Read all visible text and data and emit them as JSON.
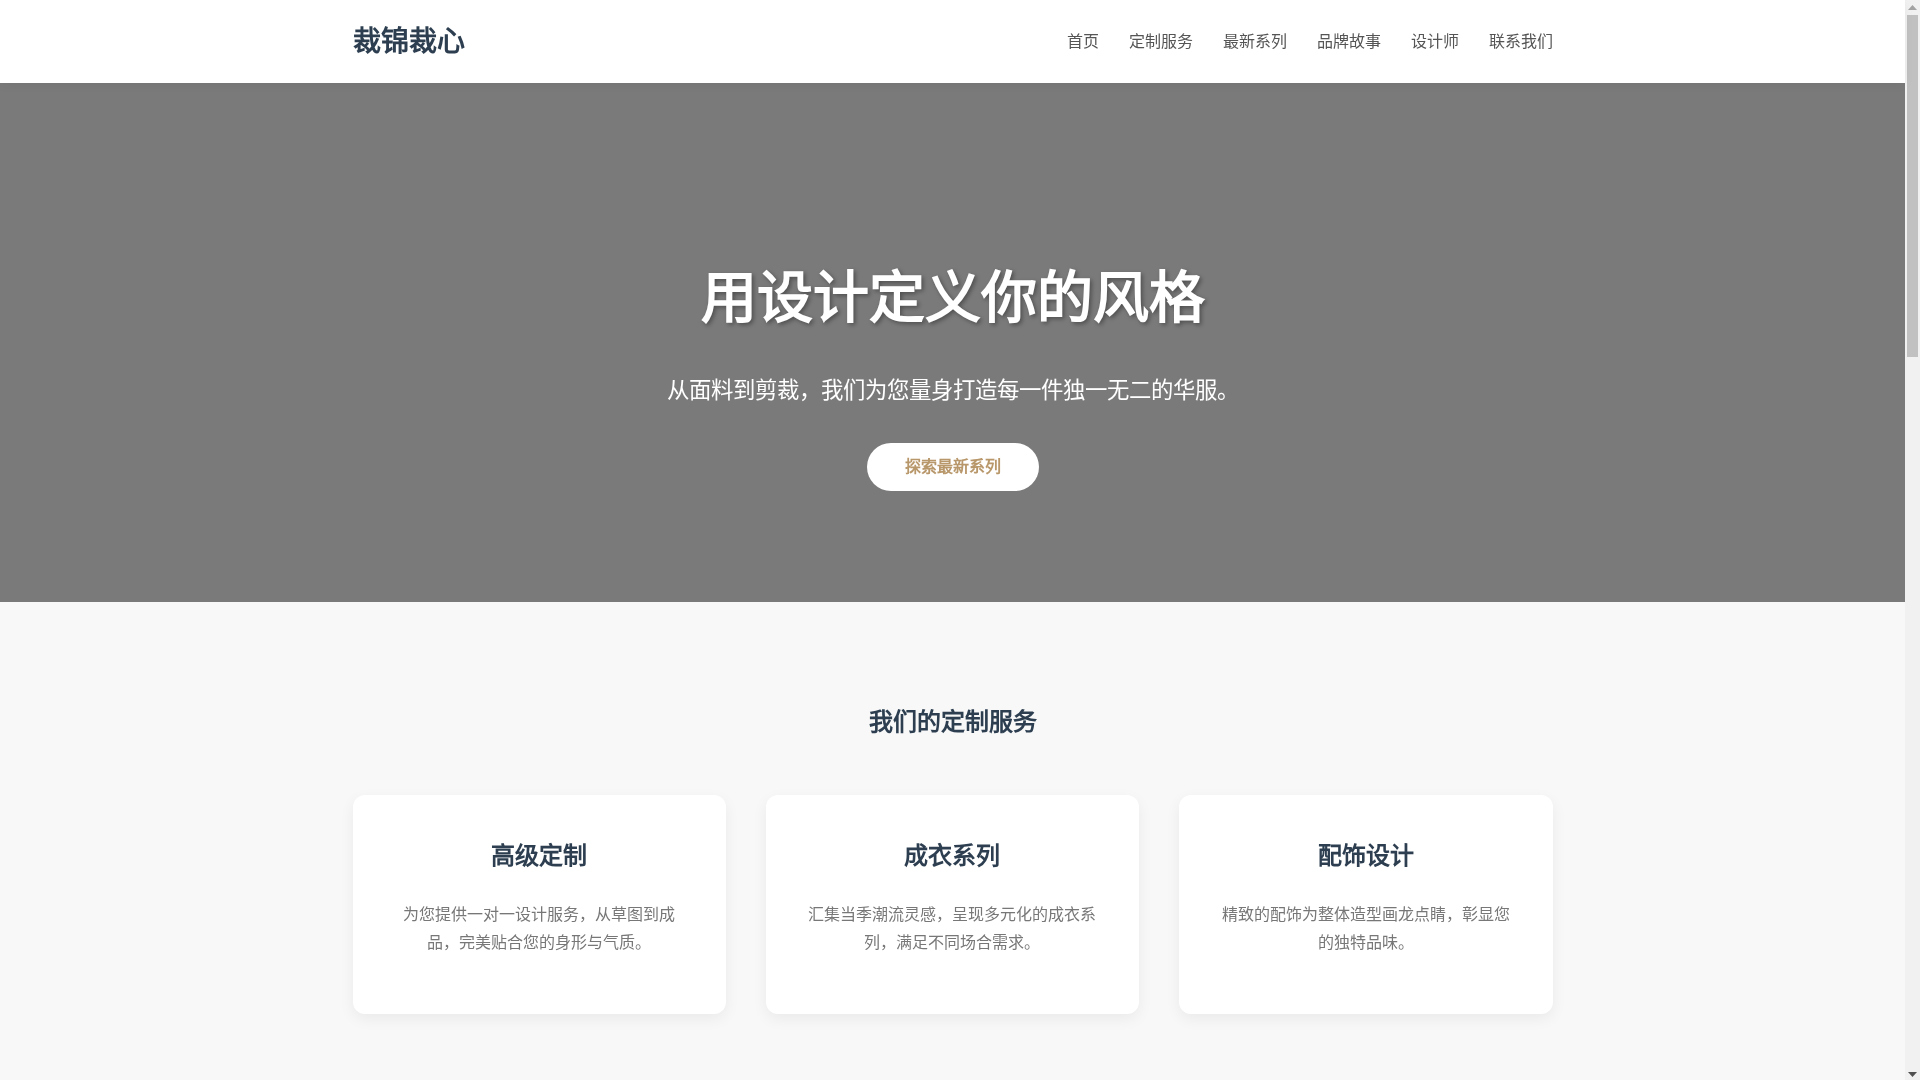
{
  "navbar": {
    "brand": "裁锦裁心",
    "links": [
      {
        "label": "首页"
      },
      {
        "label": "定制服务"
      },
      {
        "label": "最新系列"
      },
      {
        "label": "品牌故事"
      },
      {
        "label": "设计师"
      },
      {
        "label": "联系我们"
      }
    ]
  },
  "hero": {
    "title": "用设计定义你的风格",
    "subtitle": "从面料到剪裁，我们为您量身打造每一件独一无二的华服。",
    "button": "探索最新系列"
  },
  "services": {
    "title": "我们的定制服务",
    "cards": [
      {
        "title": "高级定制",
        "text": "为您提供一对一设计服务，从草图到成品，完美贴合您的身形与气质。"
      },
      {
        "title": "成衣系列",
        "text": "汇集当季潮流灵感，呈现多元化的成衣系列，满足不同场合需求。"
      },
      {
        "title": "配饰设计",
        "text": "精致的配饰为整体造型画龙点睛，彰显您的独特品味。"
      }
    ]
  }
}
